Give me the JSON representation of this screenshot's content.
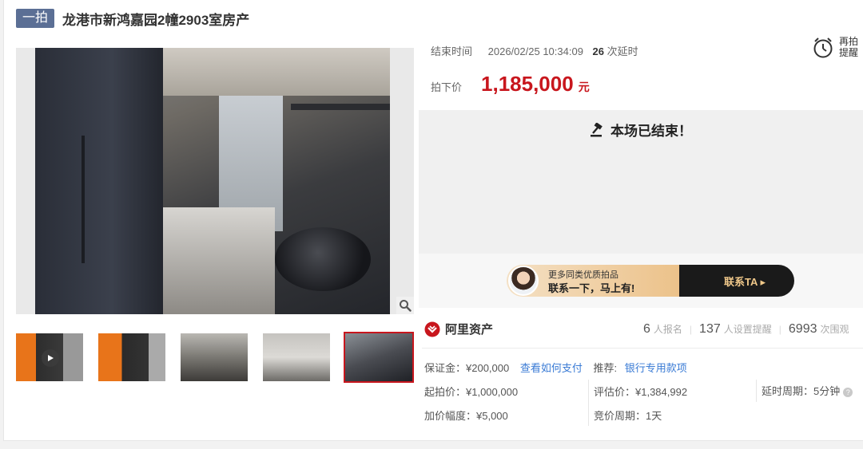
{
  "title": {
    "round": "一拍",
    "name": "龙港市新鸿嘉园2幢2903室房产"
  },
  "auction": {
    "end_label": "结束时间",
    "end_time": "2026/02/25 10:34:09",
    "delay_count": "26",
    "delay_suffix": "次延时",
    "price_label": "拍下价",
    "price": "1,185,000",
    "price_unit": "元",
    "remind_line1": "再拍",
    "remind_line2": "提醒",
    "ended_text": "本场已结束！"
  },
  "promo": {
    "line1": "更多同类优质拍品",
    "line2": "联系一下，马上有!",
    "cta": "联系TA ▸"
  },
  "brand": {
    "name": "阿里资产"
  },
  "stats": {
    "signups": "6",
    "signups_label": "人报名",
    "reminders": "137",
    "reminders_label": "人设置提醒",
    "views": "6993",
    "views_label": "次围观"
  },
  "details": {
    "deposit": "保证金：¥200,000",
    "pay_link": "查看如何支付",
    "recommend_label": "推荐:",
    "recommend_link": "银行专用款项",
    "start_price": "起拍价：¥1,000,000",
    "appraisal": "评估价：¥1,384,992",
    "delay_period": "延时周期：5分钟",
    "increment": "加价幅度：¥5,000",
    "bid_period": "竞价周期：1天"
  },
  "colors": {
    "accent_red": "#c8161d",
    "badge_blue": "#5b6f95",
    "link_blue": "#3a7bd5"
  }
}
